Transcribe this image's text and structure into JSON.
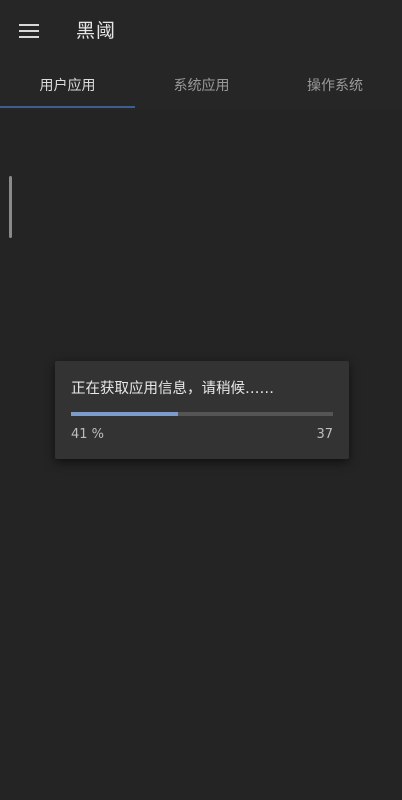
{
  "app": {
    "title": "黑阈"
  },
  "toolbar": {
    "menu_icon": "hamburger-menu-icon"
  },
  "tabs": [
    {
      "label": "用户应用",
      "selected": true
    },
    {
      "label": "系统应用",
      "selected": false
    },
    {
      "label": "操作系统",
      "selected": false
    }
  ],
  "dialog": {
    "message": "正在获取应用信息，请稍候……",
    "progress_fraction": 0.41,
    "percent_text": "41 %",
    "count_text": "37"
  },
  "colors": {
    "background": "#242424",
    "accent": "#3d5f8f",
    "progress": "#7c9ccc",
    "dialog": "#333333"
  }
}
